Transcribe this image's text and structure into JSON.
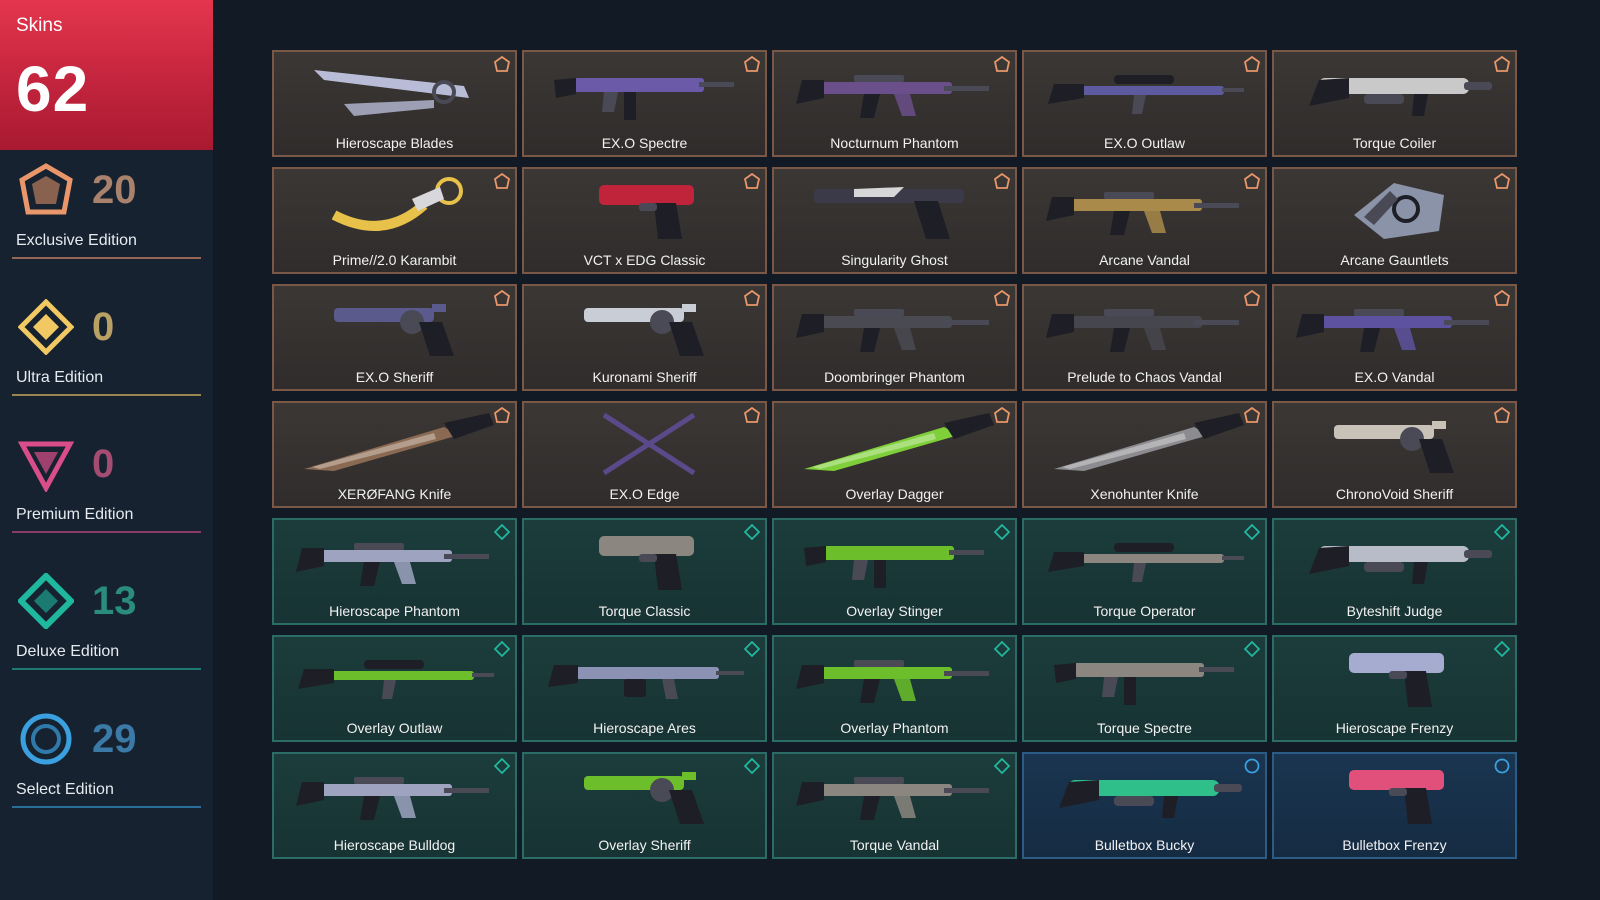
{
  "summary": {
    "label": "Skins",
    "total": "62"
  },
  "tiers": [
    {
      "id": "exclusive",
      "name": "Exclusive Edition",
      "count": "20",
      "color": "#e8966a",
      "count_color": "#a8826c",
      "icon": "exclusive-edition-icon"
    },
    {
      "id": "ultra",
      "name": "Ultra Edition",
      "count": "0",
      "color": "#f2c862",
      "count_color": "#b9a064",
      "icon": "ultra-edition-icon"
    },
    {
      "id": "premium",
      "name": "Premium Edition",
      "count": "0",
      "color": "#d94e8a",
      "count_color": "#a34d72",
      "icon": "premium-edition-icon"
    },
    {
      "id": "deluxe",
      "name": "Deluxe Edition",
      "count": "13",
      "color": "#1fb89e",
      "count_color": "#2a8c7c",
      "icon": "deluxe-edition-icon"
    },
    {
      "id": "select",
      "name": "Select Edition",
      "count": "29",
      "color": "#3aa0df",
      "count_color": "#3b7aa6",
      "icon": "select-edition-icon"
    }
  ],
  "skins": [
    {
      "name": "Hieroscape Blades",
      "tier": "exclusive",
      "weapon": "melee-blades",
      "accent": "#b8bcd6"
    },
    {
      "name": "EX.O Spectre",
      "tier": "exclusive",
      "weapon": "smg",
      "accent": "#6a5aa8"
    },
    {
      "name": "Nocturnum Phantom",
      "tier": "exclusive",
      "weapon": "rifle",
      "accent": "#6b4f8a"
    },
    {
      "name": "EX.O Outlaw",
      "tier": "exclusive",
      "weapon": "sniper",
      "accent": "#5e5aa0"
    },
    {
      "name": "Torque Coiler",
      "tier": "exclusive",
      "weapon": "shotgun",
      "accent": "#c9c9c9"
    },
    {
      "name": "Prime//2.0 Karambit",
      "tier": "exclusive",
      "weapon": "karambit",
      "accent": "#e8c14a"
    },
    {
      "name": "VCT x EDG Classic",
      "tier": "exclusive",
      "weapon": "pistol",
      "accent": "#c0243a"
    },
    {
      "name": "Singularity Ghost",
      "tier": "exclusive",
      "weapon": "pistol-long",
      "accent": "#3a3a48"
    },
    {
      "name": "Arcane Vandal",
      "tier": "exclusive",
      "weapon": "rifle",
      "accent": "#a98a4a"
    },
    {
      "name": "Arcane Gauntlets",
      "tier": "exclusive",
      "weapon": "gauntlet",
      "accent": "#8a93a8"
    },
    {
      "name": "EX.O Sheriff",
      "tier": "exclusive",
      "weapon": "revolver",
      "accent": "#5a5a8c"
    },
    {
      "name": "Kuronami Sheriff",
      "tier": "exclusive",
      "weapon": "revolver",
      "accent": "#c8cdd6"
    },
    {
      "name": "Doombringer Phantom",
      "tier": "exclusive",
      "weapon": "rifle",
      "accent": "#4a4a52"
    },
    {
      "name": "Prelude to Chaos Vandal",
      "tier": "exclusive",
      "weapon": "rifle",
      "accent": "#46464e"
    },
    {
      "name": "EX.O Vandal",
      "tier": "exclusive",
      "weapon": "rifle",
      "accent": "#5d52a0"
    },
    {
      "name": "XERØFANG Knife",
      "tier": "exclusive",
      "weapon": "knife",
      "accent": "#8a6a52"
    },
    {
      "name": "EX.O Edge",
      "tier": "exclusive",
      "weapon": "crossed-blades",
      "accent": "#5a4a8a"
    },
    {
      "name": "Overlay Dagger",
      "tier": "exclusive",
      "weapon": "knife",
      "accent": "#7fcf3a"
    },
    {
      "name": "Xenohunter Knife",
      "tier": "exclusive",
      "weapon": "knife",
      "accent": "#8c8c90"
    },
    {
      "name": "ChronoVoid Sheriff",
      "tier": "exclusive",
      "weapon": "revolver",
      "accent": "#c8c2b8"
    },
    {
      "name": "Hieroscape Phantom",
      "tier": "deluxe",
      "weapon": "rifle",
      "accent": "#9ea3bf"
    },
    {
      "name": "Torque Classic",
      "tier": "deluxe",
      "weapon": "pistol",
      "accent": "#8c8680"
    },
    {
      "name": "Overlay Stinger",
      "tier": "deluxe",
      "weapon": "smg",
      "accent": "#6cbf2a"
    },
    {
      "name": "Torque Operator",
      "tier": "deluxe",
      "weapon": "sniper",
      "accent": "#8c8680"
    },
    {
      "name": "Byteshift Judge",
      "tier": "deluxe",
      "weapon": "shotgun",
      "accent": "#b8bcc8"
    },
    {
      "name": "Overlay Outlaw",
      "tier": "deluxe",
      "weapon": "sniper",
      "accent": "#6cbf2a"
    },
    {
      "name": "Hieroscape Ares",
      "tier": "deluxe",
      "weapon": "lmg",
      "accent": "#8c92b4"
    },
    {
      "name": "Overlay Phantom",
      "tier": "deluxe",
      "weapon": "rifle",
      "accent": "#6cbf2a"
    },
    {
      "name": "Torque Spectre",
      "tier": "deluxe",
      "weapon": "smg",
      "accent": "#8c8680"
    },
    {
      "name": "Hieroscape Frenzy",
      "tier": "deluxe",
      "weapon": "pistol",
      "accent": "#a6acd0"
    },
    {
      "name": "Hieroscape Bulldog",
      "tier": "deluxe",
      "weapon": "rifle",
      "accent": "#9ea3bf"
    },
    {
      "name": "Overlay Sheriff",
      "tier": "deluxe",
      "weapon": "revolver",
      "accent": "#6cbf2a"
    },
    {
      "name": "Torque Vandal",
      "tier": "deluxe",
      "weapon": "rifle",
      "accent": "#8c8680"
    },
    {
      "name": "Bulletbox Bucky",
      "tier": "select",
      "weapon": "shotgun",
      "accent": "#2fbf8a"
    },
    {
      "name": "Bulletbox Frenzy",
      "tier": "select",
      "weapon": "pistol",
      "accent": "#e0507a"
    }
  ]
}
